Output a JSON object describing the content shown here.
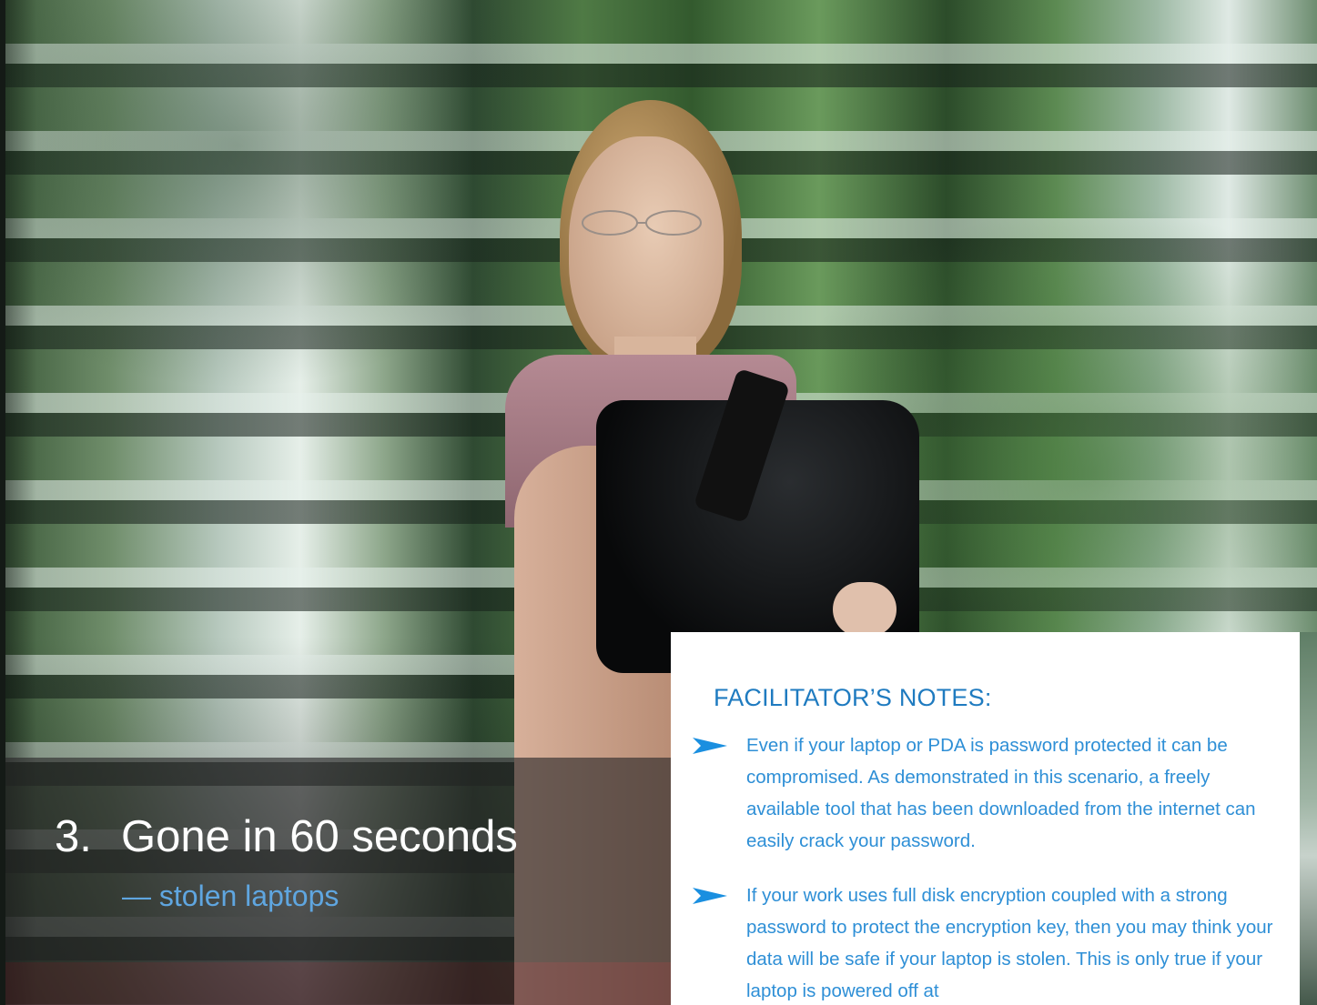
{
  "slide": {
    "title_number": "3.",
    "title_text": "Gone in 60 seconds",
    "subtitle": "— stolen laptops"
  },
  "notes": {
    "heading": "FACILITATOR’S NOTES:",
    "items": [
      {
        "text": "Even if your laptop or PDA is password protected it can be compromised. As demonstrated in this scenario, a freely available tool that has been downloaded from the internet can easily crack your password."
      },
      {
        "text": "If your work uses full disk encryption coupled with a strong password to protect the encryption key, then you may think your data will be safe if your laptop is stolen. This is only true if your laptop is powered off at"
      }
    ]
  },
  "colors": {
    "accent_blue": "#2e8fd6",
    "heading_blue": "#1f7bc0",
    "subtitle_blue": "#5fa6e0",
    "bullet_blue": "#1a8fe0"
  },
  "icons": {
    "bullet": "arrowhead-bullet-icon"
  }
}
